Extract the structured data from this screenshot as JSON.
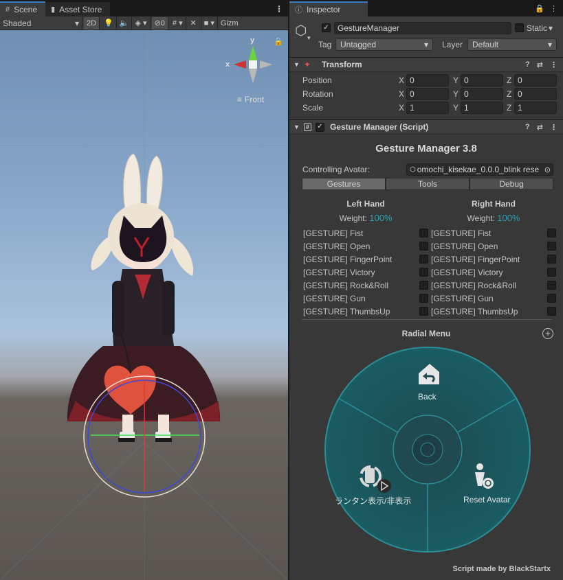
{
  "scene": {
    "tabs": [
      {
        "label": "Scene",
        "icon": "grid-icon"
      },
      {
        "label": "Asset Store",
        "icon": "shopping-bag-icon"
      }
    ],
    "toolbar": {
      "shading_mode": "Shaded",
      "mode_2d": "2D",
      "hidden_count": "0",
      "gizmos_label": "Gizm"
    },
    "orientation_gizmo": {
      "x_label": "x",
      "y_label": "y",
      "view_label": "Front"
    }
  },
  "inspector": {
    "tab_label": "Inspector",
    "object_name": "GestureManager",
    "static_label": "Static",
    "tag_label": "Tag",
    "tag_value": "Untagged",
    "layer_label": "Layer",
    "layer_value": "Default",
    "transform": {
      "title": "Transform",
      "rows": [
        {
          "label": "Position",
          "x": "0",
          "y": "0",
          "z": "0"
        },
        {
          "label": "Rotation",
          "x": "0",
          "y": "0",
          "z": "0"
        },
        {
          "label": "Scale",
          "x": "1",
          "y": "1",
          "z": "1"
        }
      ],
      "axis_x": "X",
      "axis_y": "Y",
      "axis_z": "Z"
    },
    "gesture_manager": {
      "component_title": "Gesture Manager (Script)",
      "title": "Gesture Manager 3.8",
      "controlling_label": "Controlling Avatar:",
      "controlling_value": "omochi_kisekae_0.0.0_blink rese",
      "tabs": [
        "Gestures",
        "Tools",
        "Debug"
      ],
      "left_hand": {
        "title": "Left Hand",
        "weight_label": "Weight:",
        "weight_value": "100%",
        "gestures": [
          "[GESTURE] Fist",
          "[GESTURE] Open",
          "[GESTURE] FingerPoint",
          "[GESTURE] Victory",
          "[GESTURE] Rock&Roll",
          "[GESTURE] Gun",
          "[GESTURE] ThumbsUp"
        ]
      },
      "right_hand": {
        "title": "Right Hand",
        "weight_label": "Weight:",
        "weight_value": "100%",
        "gestures": [
          "[GESTURE] Fist",
          "[GESTURE] Open",
          "[GESTURE] FingerPoint",
          "[GESTURE] Victory",
          "[GESTURE] Rock&Roll",
          "[GESTURE] Gun",
          "[GESTURE] ThumbsUp"
        ]
      },
      "radial_menu": {
        "title": "Radial Menu",
        "items": [
          {
            "label": "Back",
            "icon": "back-home-icon"
          },
          {
            "label": "ランタン表示/非表示",
            "icon": "lantern-toggle-icon"
          },
          {
            "label": "Reset Avatar",
            "icon": "reset-avatar-icon"
          }
        ]
      },
      "footer": "Script made by BlackStartx"
    }
  },
  "colors": {
    "accent": "#3a79bb",
    "teal": "#2aa4b8",
    "radial_bg": "#1e4d55",
    "radial_ring": "#2b8d96"
  }
}
